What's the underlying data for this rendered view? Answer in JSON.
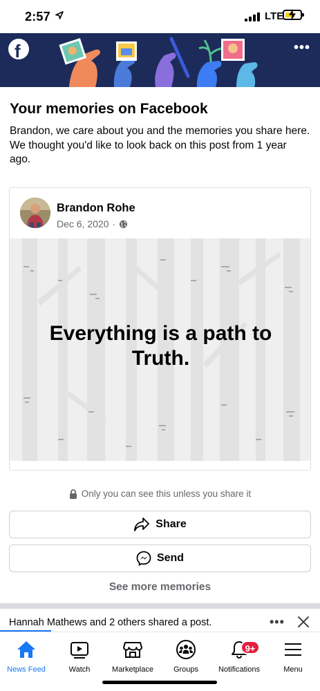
{
  "status_bar": {
    "time": "2:57",
    "network": "LTE",
    "icons": [
      "location-arrow-icon",
      "signal-icon",
      "battery-charging-icon"
    ]
  },
  "banner": {
    "logo_letter": "f",
    "more_label": "•••"
  },
  "memories": {
    "title": "Your memories on Facebook",
    "description": "Brandon, we care about you and the memories you share here. We thought you'd like to look back on this post from 1 year ago."
  },
  "post": {
    "author": "Brandon Rohe",
    "date": "Dec 6, 2020",
    "separator": "·",
    "audience_icon": "globe-icon",
    "text": "Everything is a path to Truth."
  },
  "privacy": {
    "text": "Only you can see this unless you share it",
    "icon": "lock-icon"
  },
  "actions": {
    "share_label": "Share",
    "send_label": "Send",
    "see_more_label": "See more memories"
  },
  "notification_strip": {
    "text": "Hannah Mathews and 2 others shared a post.",
    "more_label": "•••"
  },
  "tabs": [
    {
      "label": "News Feed",
      "icon": "home-icon",
      "active": true
    },
    {
      "label": "Watch",
      "icon": "watch-icon",
      "active": false
    },
    {
      "label": "Marketplace",
      "icon": "marketplace-icon",
      "active": false
    },
    {
      "label": "Groups",
      "icon": "groups-icon",
      "active": false
    },
    {
      "label": "Notifications",
      "icon": "bell-icon",
      "active": false,
      "badge": "9+"
    },
    {
      "label": "Menu",
      "icon": "menu-icon",
      "active": false
    }
  ],
  "colors": {
    "brand_blue": "#1877f2",
    "banner_navy": "#1c2b5a",
    "badge_red": "#e41e3f",
    "secondary_text": "#65676b"
  }
}
